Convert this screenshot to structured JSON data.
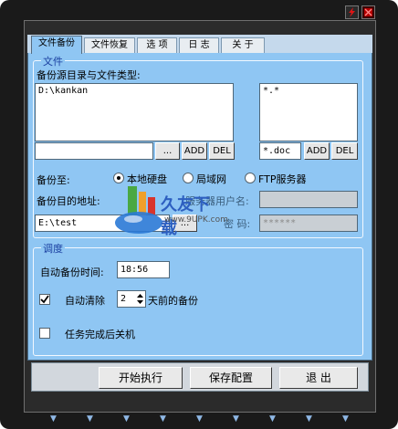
{
  "window": {
    "minimize_icon": "lightning-icon",
    "close_icon": "close-icon"
  },
  "tabs": [
    {
      "label": "文件备份",
      "active": true
    },
    {
      "label": "文件恢复",
      "active": false
    },
    {
      "label": "选 项",
      "active": false
    },
    {
      "label": "日 志",
      "active": false
    },
    {
      "label": "关 于",
      "active": false
    }
  ],
  "file_group": {
    "title": "文件",
    "source_label": "备份源目录与文件类型:",
    "source_list": "D:\\kankan",
    "source_input": "",
    "browse_label": "...",
    "add_label": "ADD",
    "del_label": "DEL",
    "type_list": "*.*",
    "type_input": "*.doc",
    "type_add_label": "ADD",
    "type_del_label": "DEL",
    "backup_to_label": "备份至:",
    "target_options": [
      {
        "label": "本地硬盘",
        "selected": true
      },
      {
        "label": "局域网",
        "selected": false
      },
      {
        "label": "FTP服务器",
        "selected": false
      }
    ],
    "dest_label": "备份目的地址:",
    "dest_value": "E:\\test",
    "dest_browse_label": "...",
    "server_user_label": "服务器用户名:",
    "server_user_value": "",
    "password_label": "密 码:",
    "password_value": "******"
  },
  "schedule_group": {
    "title": "调度",
    "auto_time_label": "自动备份时间:",
    "auto_time_value": "18:56",
    "auto_clean_label": "自动清除",
    "auto_clean_checked": true,
    "auto_clean_days": "2",
    "auto_clean_suffix": "天前的备份",
    "shutdown_label": "任务完成后关机",
    "shutdown_checked": false
  },
  "actions": {
    "start_label": "开始执行",
    "save_label": "保存配置",
    "exit_label": "退 出"
  },
  "watermark": {
    "text": "久友下载",
    "url": "www.9UPK.com"
  },
  "colors": {
    "panel": "#8fc6f3",
    "frame": "#1a1a1a",
    "group_title": "#1a3fa0",
    "accent_icon": "#c00000"
  }
}
